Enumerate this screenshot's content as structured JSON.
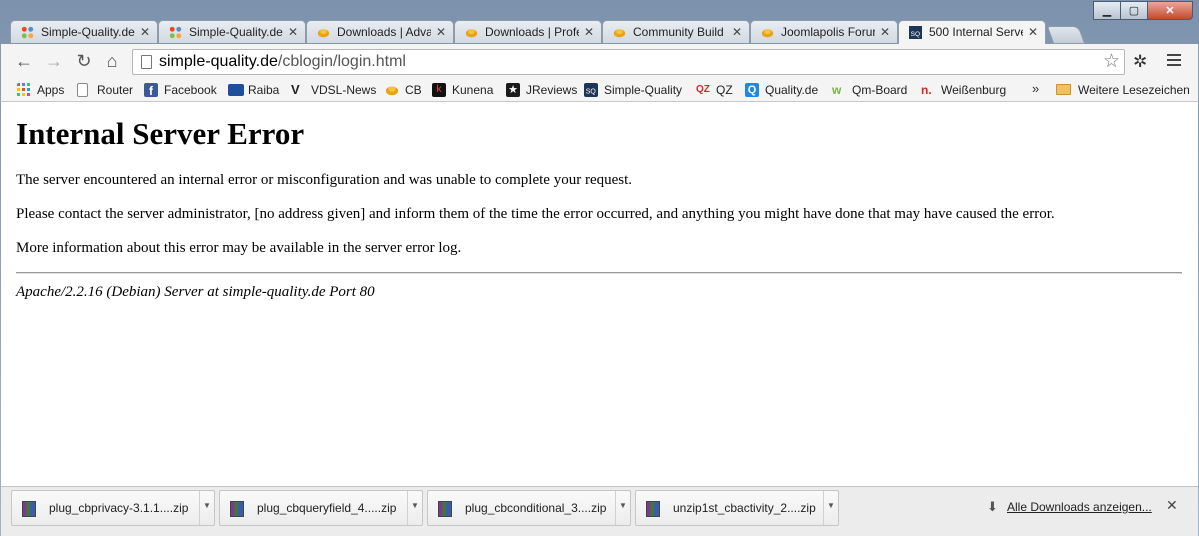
{
  "window": {
    "minimize": "▁",
    "maximize": "▢",
    "close": "✕"
  },
  "tabs": [
    {
      "label": "Simple-Quality.de",
      "icon": "joomla-icon",
      "active": false
    },
    {
      "label": "Simple-Quality.de",
      "icon": "joomla-icon",
      "active": false
    },
    {
      "label": "Downloads | Adva",
      "icon": "joomlapolis-icon",
      "active": false
    },
    {
      "label": "Downloads | Profe",
      "icon": "joomlapolis-icon",
      "active": false
    },
    {
      "label": "Community Build",
      "icon": "joomlapolis-icon",
      "active": false
    },
    {
      "label": "Joomlapolis Forur",
      "icon": "joomlapolis-icon",
      "active": false
    },
    {
      "label": "500 Internal Serve",
      "icon": "sq-icon",
      "active": true
    }
  ],
  "toolbar": {
    "back": "←",
    "forward": "→",
    "reload": "↻",
    "home": "⌂",
    "url_host": "simple-quality.de",
    "url_path": "/cblogin/login.html",
    "star": "☆"
  },
  "bookmarks": [
    {
      "label": "Apps",
      "icon": "apps-grid-icon",
      "color": "#4a90d9"
    },
    {
      "label": "Router",
      "icon": "page-icon",
      "color": "#ffffff"
    },
    {
      "label": "Facebook",
      "icon": "facebook-icon",
      "color": "#3b5998"
    },
    {
      "label": "Raiba",
      "icon": "raiba-icon",
      "color": "#1d4f9c"
    },
    {
      "label": "VDSL-News",
      "icon": "vdsl-icon",
      "color": "#222222"
    },
    {
      "label": "CB",
      "icon": "joomlapolis-icon",
      "color": "#e8a317"
    },
    {
      "label": "Kunena",
      "icon": "kunena-icon",
      "color": "#111111"
    },
    {
      "label": "JReviews",
      "icon": "jreviews-icon",
      "color": "#1a1a1a"
    },
    {
      "label": "Simple-Quality",
      "icon": "sq-icon",
      "color": "#1d3557"
    },
    {
      "label": "QZ",
      "icon": "qz-icon",
      "color": "#d62828"
    },
    {
      "label": "Quality.de",
      "icon": "quality-icon",
      "color": "#1e88e5"
    },
    {
      "label": "Qm-Board",
      "icon": "qmboard-icon",
      "color": "#7cb342"
    },
    {
      "label": "Weißenburg",
      "icon": "weissenburg-icon",
      "color": "#d62828"
    }
  ],
  "bookmarks_more": "»",
  "bookmarks_folder": "Weitere Lesezeichen",
  "page": {
    "heading": "Internal Server Error",
    "para1": "The server encountered an internal error or misconfiguration and was unable to complete your request.",
    "para2": "Please contact the server administrator, [no address given] and inform them of the time the error occurred, and anything you might have done that may have caused the error.",
    "para3": "More information about this error may be available in the server error log.",
    "signature": "Apache/2.2.16 (Debian) Server at simple-quality.de Port 80"
  },
  "downloads": [
    {
      "name": "plug_cbprivacy-3.1.1....zip"
    },
    {
      "name": "plug_cbqueryfield_4.....zip"
    },
    {
      "name": "plug_cbconditional_3....zip"
    },
    {
      "name": "unzip1st_cbactivity_2....zip"
    }
  ],
  "downloads_all": "Alle Downloads anzeigen...",
  "shelf_close": "✕"
}
